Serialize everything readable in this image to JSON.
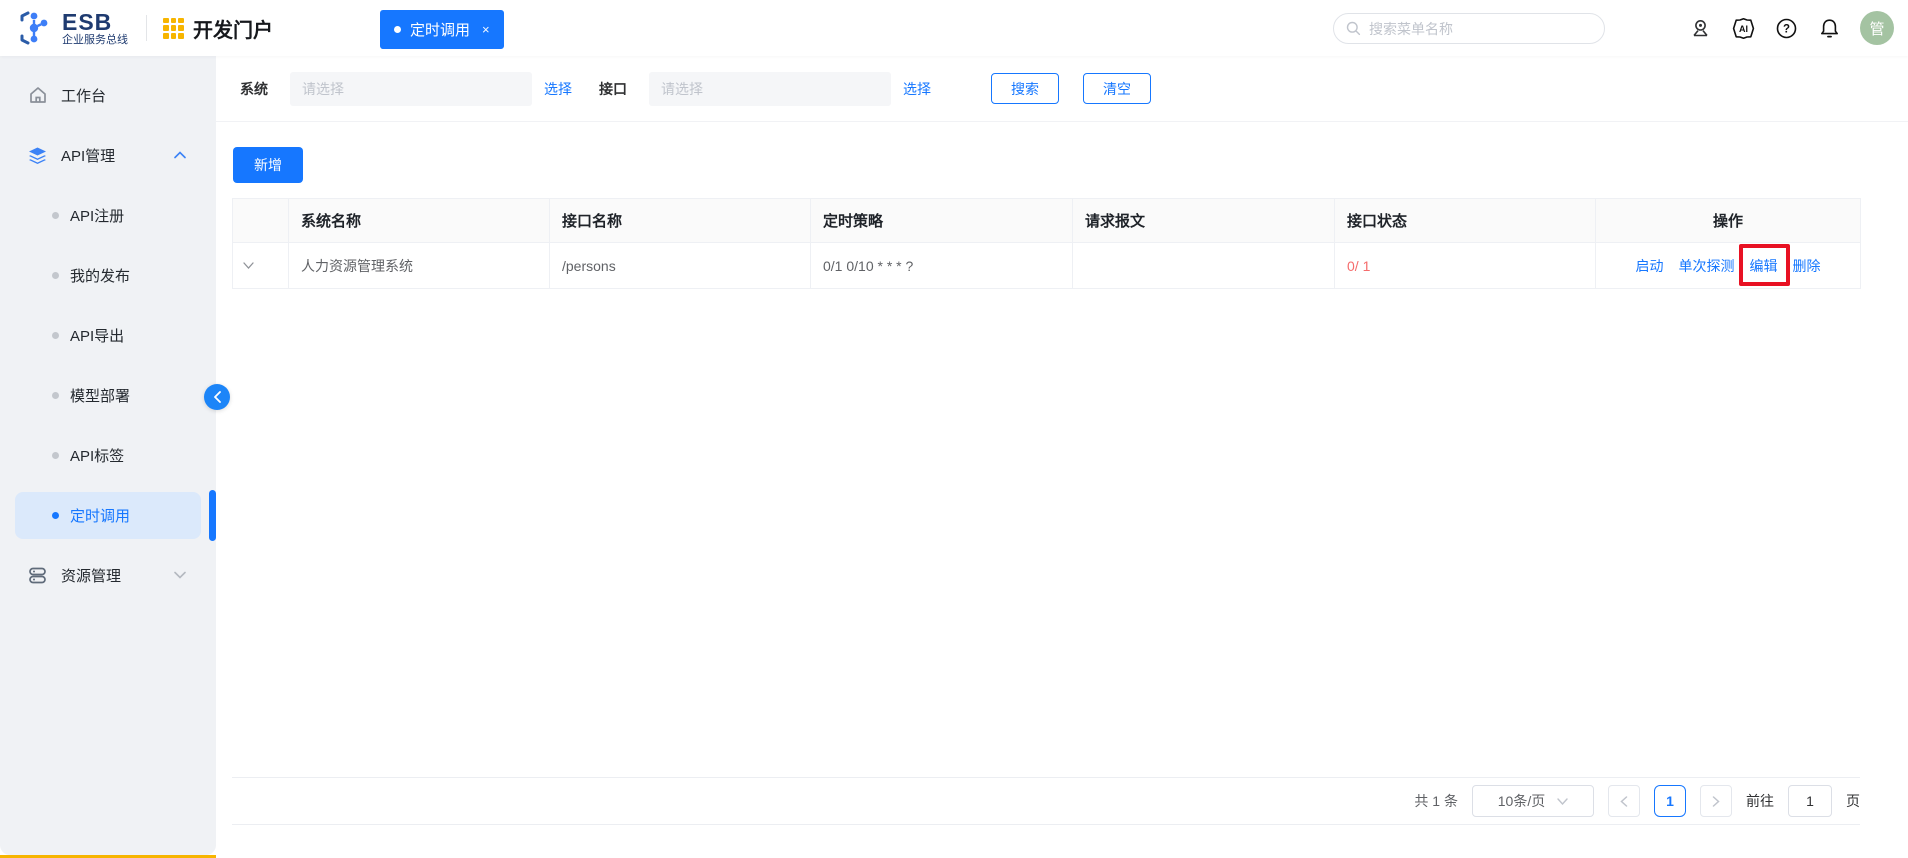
{
  "header": {
    "logo_title": "ESB",
    "logo_subtitle": "企业服务总线",
    "portal_title": "开发门户",
    "tab_label": "定时调用",
    "tab_close": "×",
    "search_placeholder": "搜索菜单名称",
    "avatar_label": "管"
  },
  "sidebar": {
    "items": [
      {
        "label": "工作台"
      },
      {
        "label": "API管理"
      },
      {
        "label": "API注册"
      },
      {
        "label": "我的发布"
      },
      {
        "label": "API导出"
      },
      {
        "label": "模型部署"
      },
      {
        "label": "API标签"
      },
      {
        "label": "定时调用"
      },
      {
        "label": "资源管理"
      }
    ]
  },
  "filters": {
    "system_label": "系统",
    "interface_label": "接口",
    "select_placeholder": "请选择",
    "choose_link": "选择",
    "search_button": "搜索",
    "clear_button": "清空"
  },
  "toolbar": {
    "add_button": "新增"
  },
  "table": {
    "columns": [
      "系统名称",
      "接口名称",
      "定时策略",
      "请求报文",
      "接口状态",
      "操作"
    ],
    "rows": [
      {
        "system_name": "人力资源管理系统",
        "interface_name": "/persons",
        "cron": "0/1 0/10 * * * ?",
        "request_body": "",
        "status": "0/ 1",
        "actions": [
          "启动",
          "单次探测",
          "编辑",
          "删除"
        ]
      }
    ]
  },
  "pagination": {
    "total": "共 1 条",
    "page_size": "10条/页",
    "current_page": "1",
    "goto_label": "前往",
    "goto_value": "1",
    "page_unit": "页"
  },
  "colors": {
    "primary": "#1677ff",
    "status_red": "#f56c6c",
    "annotation_red": "#e81123",
    "brand_orange": "#f7b500",
    "avatar_green": "#a4c3a2",
    "sidebar_bg": "#f0f2f5",
    "selected_bg": "#dbe9fb"
  }
}
